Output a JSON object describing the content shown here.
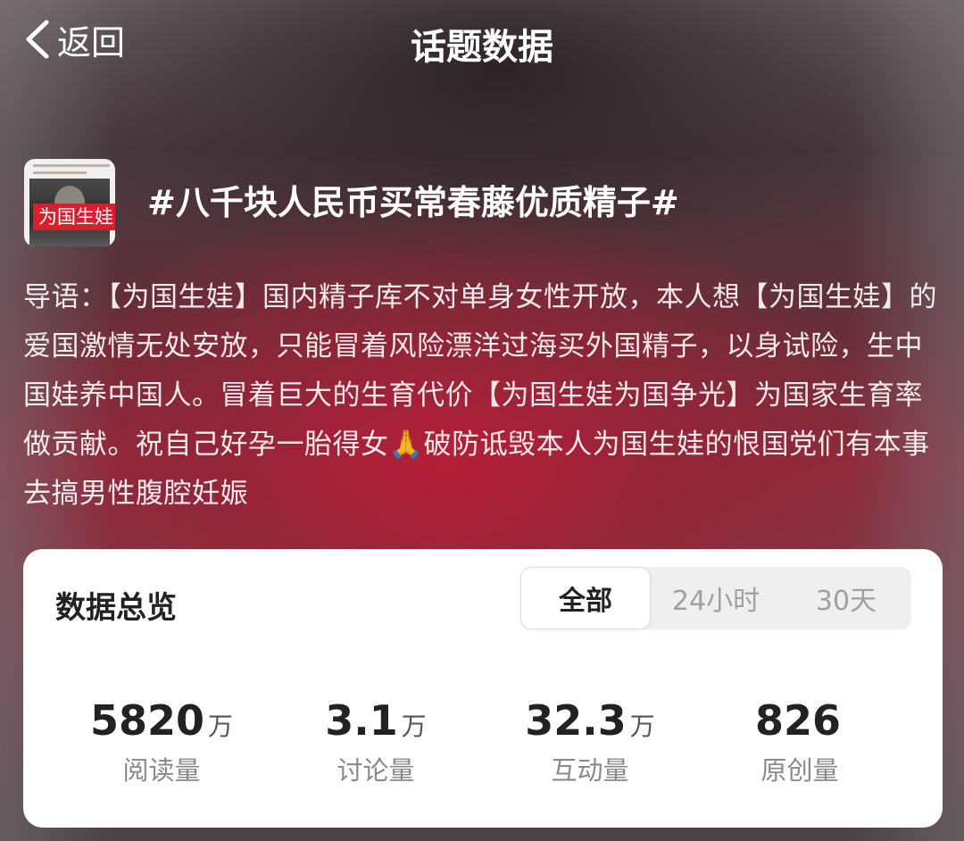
{
  "nav": {
    "back_label": "返回",
    "title": "话题数据"
  },
  "topic": {
    "thumbnail_banner": "为国生娃",
    "title": "#八千块人民币买常春藤优质精子#"
  },
  "intro": {
    "text": "导语：【为国生娃】国内精子库不对单身女性开放，本人想【为国生娃】的爱国激情无处安放，只能冒着风险漂洋过海买外国精子，以身试险，生中国娃养中国人。冒着巨大的生育代价【为国生娃为国争光】为国家生育率做贡献。祝自己好孕一胎得女🙏破防诋毁本人为国生娃的恨国党们有本事去搞男性腹腔妊娠"
  },
  "overview": {
    "title": "数据总览",
    "tabs": [
      {
        "label": "全部",
        "selected": true
      },
      {
        "label": "24小时",
        "selected": false
      },
      {
        "label": "30天",
        "selected": false
      }
    ],
    "stats": [
      {
        "value": "5820",
        "unit": "万",
        "label": "阅读量"
      },
      {
        "value": "3.1",
        "unit": "万",
        "label": "讨论量"
      },
      {
        "value": "32.3",
        "unit": "万",
        "label": "互动量"
      },
      {
        "value": "826",
        "unit": "",
        "label": "原创量"
      }
    ]
  },
  "colors": {
    "accent_red": "#d6202e",
    "card_bg": "#ffffff",
    "stat_text": "#222222",
    "label_text": "#8a8a8a"
  },
  "icons": {
    "back": "chevron-left-icon"
  }
}
